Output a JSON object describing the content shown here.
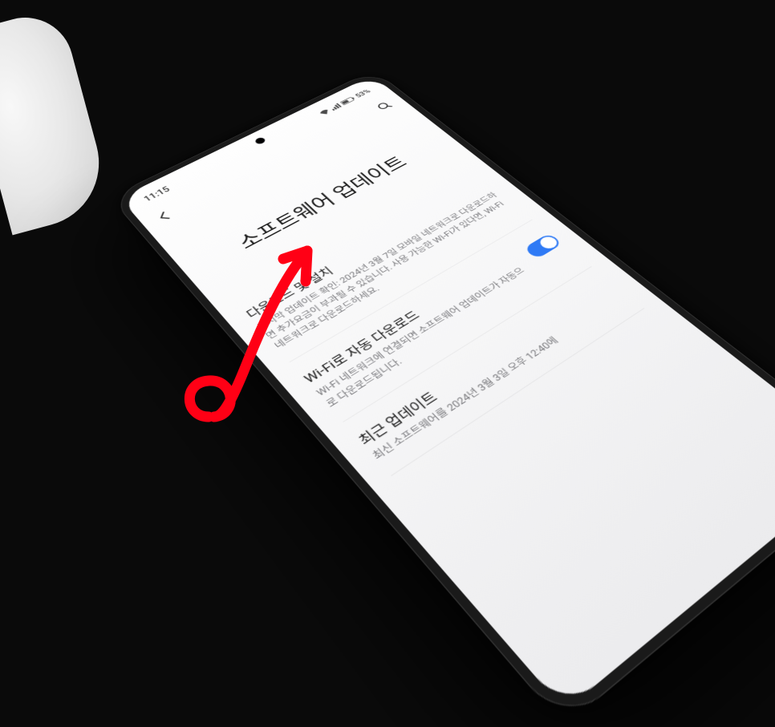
{
  "statusBar": {
    "time": "11:15",
    "battery": "53%"
  },
  "header": {
    "title": "소프트웨어 업데이트"
  },
  "items": [
    {
      "title": "다운로드 및 설치",
      "desc": "마지막 업데이트 확인: 2024년 3월 7일\n모바일 네트워크로 다운로드하면 추가요금이 부과될 수 있습니다. 사용 가능한 Wi-Fi가 있다면, Wi-Fi 네트워크로 다운로드하세요."
    },
    {
      "title": "Wi-Fi로 자동 다운로드",
      "desc": "Wi-Fi 네트워크에 연결되면 소프트웨어 업데이트가 자동으로 다운로드됩니다."
    },
    {
      "title": "최근 업데이트",
      "desc": "최신 소프트웨어를 2024년 3월 3일 오후 12:40에"
    }
  ],
  "annotation": {
    "color": "#ff0015"
  }
}
